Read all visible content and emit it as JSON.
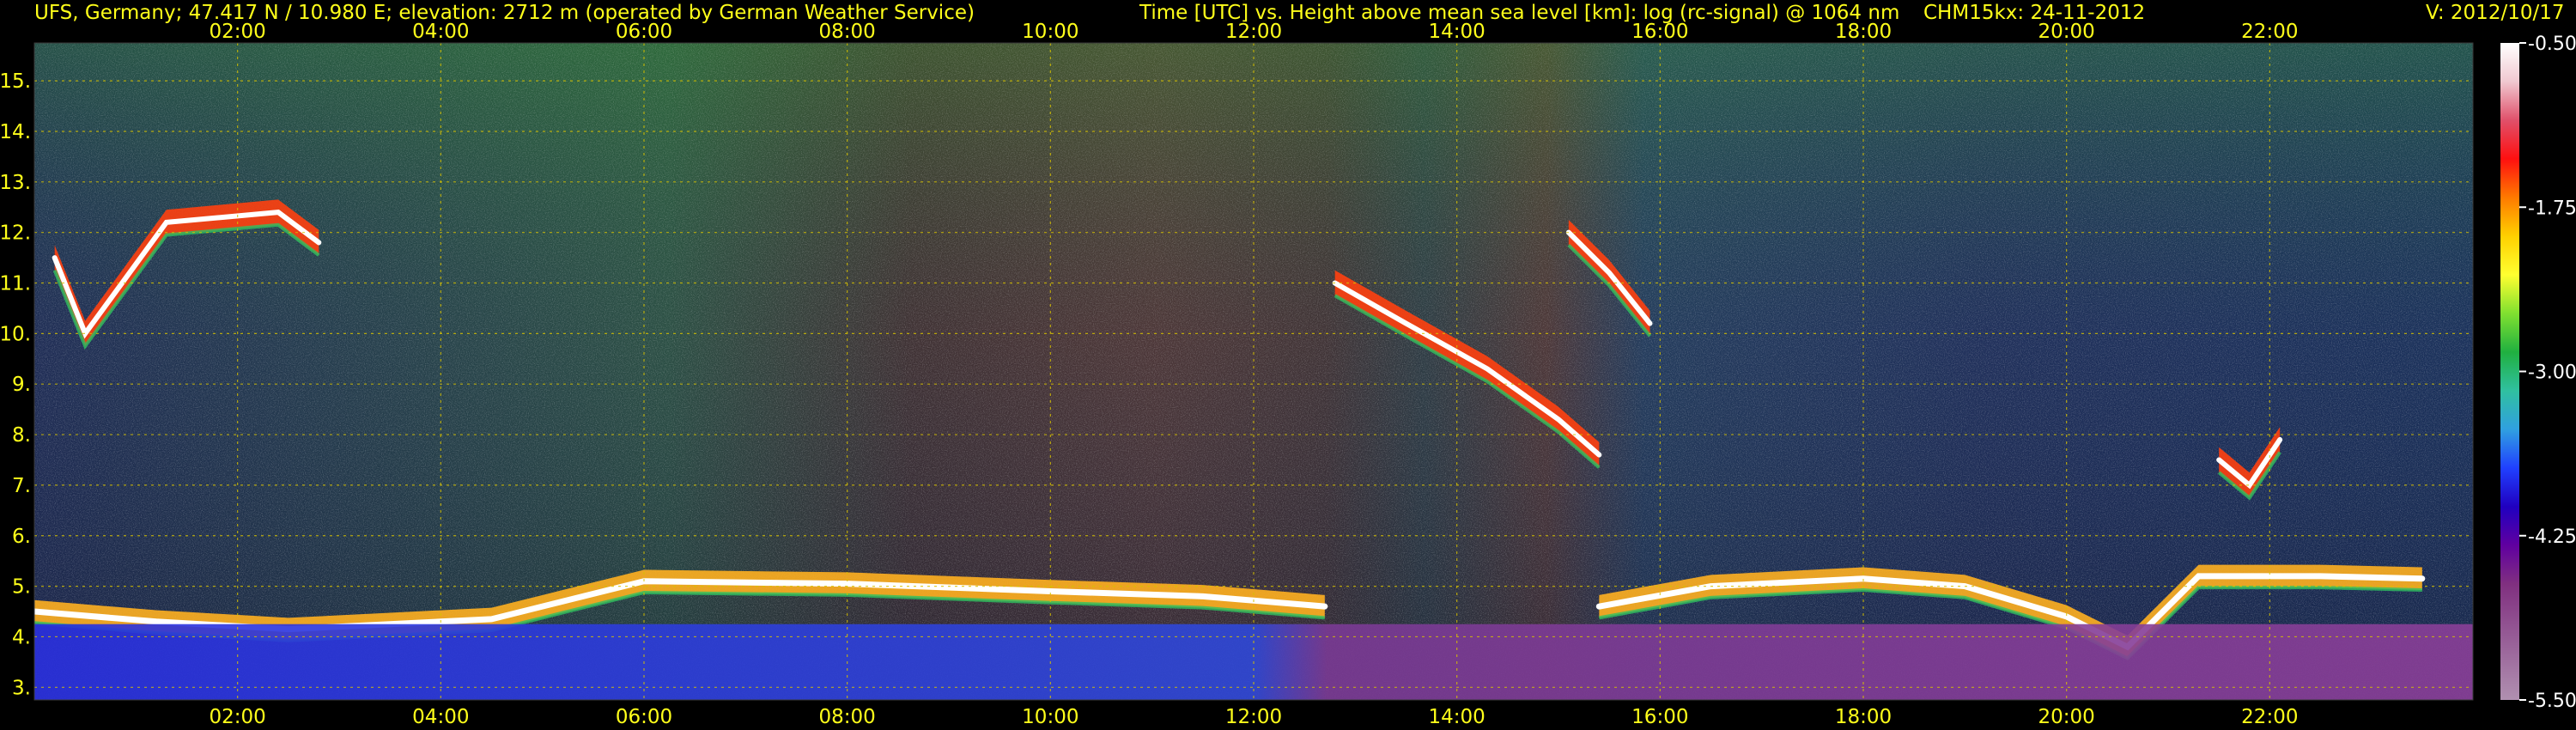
{
  "header": {
    "station": "UFS, Germany; 47.417 N / 10.980 E; elevation: 2712 m  (operated by German Weather Service)",
    "axes_desc": "Time [UTC] vs. Height above mean sea level [km]: log (rc-signal) @ 1064 nm",
    "instrument_date": "CHM15kx: 24-11-2012",
    "version": "V: 2012/10/17"
  },
  "colors": {
    "text": "#ffff1a",
    "grid": "#d8c200",
    "background": "#000000"
  },
  "chart_data": {
    "type": "heatmap",
    "x": {
      "unit": "UTC hour",
      "range": [
        0.0,
        24.0
      ],
      "ticks": [
        2,
        4,
        6,
        8,
        10,
        12,
        14,
        16,
        18,
        20,
        22
      ],
      "tick_labels": [
        "02:00",
        "04:00",
        "06:00",
        "08:00",
        "10:00",
        "12:00",
        "14:00",
        "16:00",
        "18:00",
        "20:00",
        "22:00"
      ]
    },
    "y": {
      "unit": "km",
      "range": [
        2.75,
        15.75
      ],
      "ticks": [
        3,
        4,
        5,
        6,
        7,
        8,
        9,
        10,
        11,
        12,
        13,
        14,
        15
      ],
      "tick_labels": [
        "3.",
        "4.",
        "5.",
        "6.",
        "7.",
        "8.",
        "9.",
        "10.",
        "11.",
        "12.",
        "13.",
        "14.",
        "15."
      ]
    },
    "colorbar": {
      "range": [
        -5.5,
        -0.5
      ],
      "ticks": [
        -0.5,
        -1.75,
        -3.0,
        -4.25,
        -5.5
      ],
      "tick_labels": [
        "-0.50",
        "-1.75",
        "-3.00",
        "-4.25",
        "-5.50"
      ],
      "colors": [
        "#ffffff",
        "#f0c8d0",
        "#e0506a",
        "#ff1010",
        "#ff7a00",
        "#ffd000",
        "#ffff30",
        "#80e030",
        "#20b040",
        "#30c0a0",
        "#30a0e0",
        "#2040ff",
        "#2000c0",
        "#6000a0",
        "#803080",
        "#905090",
        "#a070a0",
        "#b090b0"
      ]
    },
    "features": [
      {
        "name": "boundary_layer_top",
        "points": [
          [
            0.0,
            4.5
          ],
          [
            1.2,
            4.3
          ],
          [
            2.5,
            4.15
          ],
          [
            3.5,
            4.25
          ],
          [
            4.5,
            4.35
          ],
          [
            5.2,
            4.7
          ],
          [
            6.0,
            5.1
          ],
          [
            8.0,
            5.05
          ],
          [
            10.0,
            4.9
          ],
          [
            11.5,
            4.8
          ],
          [
            12.7,
            4.6
          ]
        ]
      },
      {
        "name": "boundary_layer_top",
        "points": [
          [
            15.4,
            4.6
          ],
          [
            16.5,
            5.0
          ],
          [
            18.0,
            5.15
          ],
          [
            19.0,
            5.0
          ],
          [
            20.0,
            4.4
          ],
          [
            20.6,
            3.8
          ],
          [
            21.3,
            5.2
          ],
          [
            22.5,
            5.2
          ],
          [
            23.5,
            5.15
          ]
        ]
      },
      {
        "name": "cirrus",
        "points": [
          [
            12.8,
            11.0
          ],
          [
            13.5,
            10.2
          ],
          [
            14.3,
            9.3
          ],
          [
            15.0,
            8.3
          ],
          [
            15.4,
            7.6
          ]
        ]
      },
      {
        "name": "cirrus",
        "points": [
          [
            0.2,
            11.5
          ],
          [
            0.5,
            10.0
          ],
          [
            1.3,
            12.2
          ],
          [
            2.4,
            12.4
          ],
          [
            2.8,
            11.8
          ]
        ]
      },
      {
        "name": "cirrus",
        "points": [
          [
            15.1,
            12.0
          ],
          [
            15.5,
            11.2
          ],
          [
            15.9,
            10.2
          ]
        ]
      },
      {
        "name": "cirrus",
        "points": [
          [
            21.5,
            7.5
          ],
          [
            21.8,
            7.0
          ],
          [
            22.1,
            7.9
          ]
        ]
      }
    ]
  }
}
